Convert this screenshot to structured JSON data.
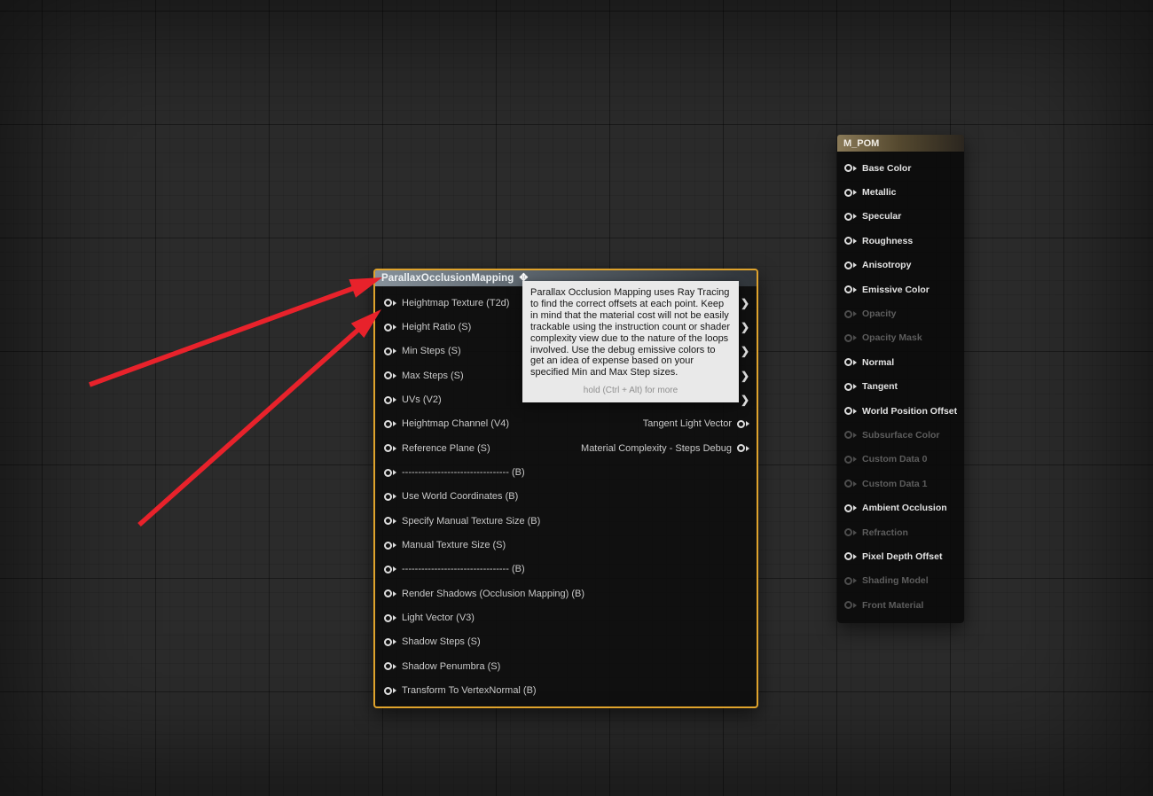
{
  "graph": {
    "icons": {
      "move_cursor": "✥",
      "output_arrow": "❯"
    },
    "colors": {
      "background": "#2b2b2b",
      "selection_outline": "#dfa32c",
      "arrow_red": "#e8222b",
      "pom_title": "#87929b",
      "mpom_title": "#8a7a58",
      "tooltip_bg": "#e9e9e9"
    },
    "pom_node": {
      "title": "ParallaxOcclusionMapping",
      "inputs": [
        {
          "label": "Heightmap Texture (T2d)"
        },
        {
          "label": "Height Ratio (S)"
        },
        {
          "label": "Min Steps (S)"
        },
        {
          "label": "Max Steps (S)"
        },
        {
          "label": "UVs (V2)"
        },
        {
          "label": "Heightmap Channel (V4)"
        },
        {
          "label": "Reference Plane (S)"
        },
        {
          "label": "--------------------------------- (B)"
        },
        {
          "label": "Use World Coordinates (B)"
        },
        {
          "label": "Specify Manual Texture Size (B)"
        },
        {
          "label": "Manual Texture Size (S)"
        },
        {
          "label": "--------------------------------- (B)"
        },
        {
          "label": "Render Shadows (Occlusion Mapping) (B)"
        },
        {
          "label": "Light Vector (V3)"
        },
        {
          "label": "Shadow Steps (S)"
        },
        {
          "label": "Shadow Penumbra (S)"
        },
        {
          "label": "Transform To VertexNormal (B)"
        }
      ],
      "unlabeled_outputs": [
        {},
        {},
        {},
        {},
        {}
      ],
      "named_outputs": [
        {
          "label": "Tangent Light Vector"
        },
        {
          "label": "Material Complexity - Steps Debug"
        }
      ]
    },
    "tooltip": {
      "body": "Parallax Occlusion Mapping uses Ray Tracing to find the correct offsets at each point. Keep in mind that the material cost will not be easily trackable using the instruction count or shader complexity view due to the nature of the loops involved. Use the debug emissive colors to get an idea of expense based on your specified Min and Max Step sizes.",
      "hint": "hold (Ctrl + Alt) for more"
    },
    "material_node": {
      "title": "M_POM",
      "pins": [
        {
          "label": "Base Color",
          "enabled": true
        },
        {
          "label": "Metallic",
          "enabled": true
        },
        {
          "label": "Specular",
          "enabled": true
        },
        {
          "label": "Roughness",
          "enabled": true
        },
        {
          "label": "Anisotropy",
          "enabled": true
        },
        {
          "label": "Emissive Color",
          "enabled": true
        },
        {
          "label": "Opacity",
          "enabled": false
        },
        {
          "label": "Opacity Mask",
          "enabled": false
        },
        {
          "label": "Normal",
          "enabled": true
        },
        {
          "label": "Tangent",
          "enabled": true
        },
        {
          "label": "World Position Offset",
          "enabled": true
        },
        {
          "label": "Subsurface Color",
          "enabled": false
        },
        {
          "label": "Custom Data 0",
          "enabled": false
        },
        {
          "label": "Custom Data 1",
          "enabled": false
        },
        {
          "label": "Ambient Occlusion",
          "enabled": true
        },
        {
          "label": "Refraction",
          "enabled": false
        },
        {
          "label": "Pixel Depth Offset",
          "enabled": true
        },
        {
          "label": "Shading Model",
          "enabled": false
        },
        {
          "label": "Front Material",
          "enabled": false
        }
      ]
    }
  }
}
